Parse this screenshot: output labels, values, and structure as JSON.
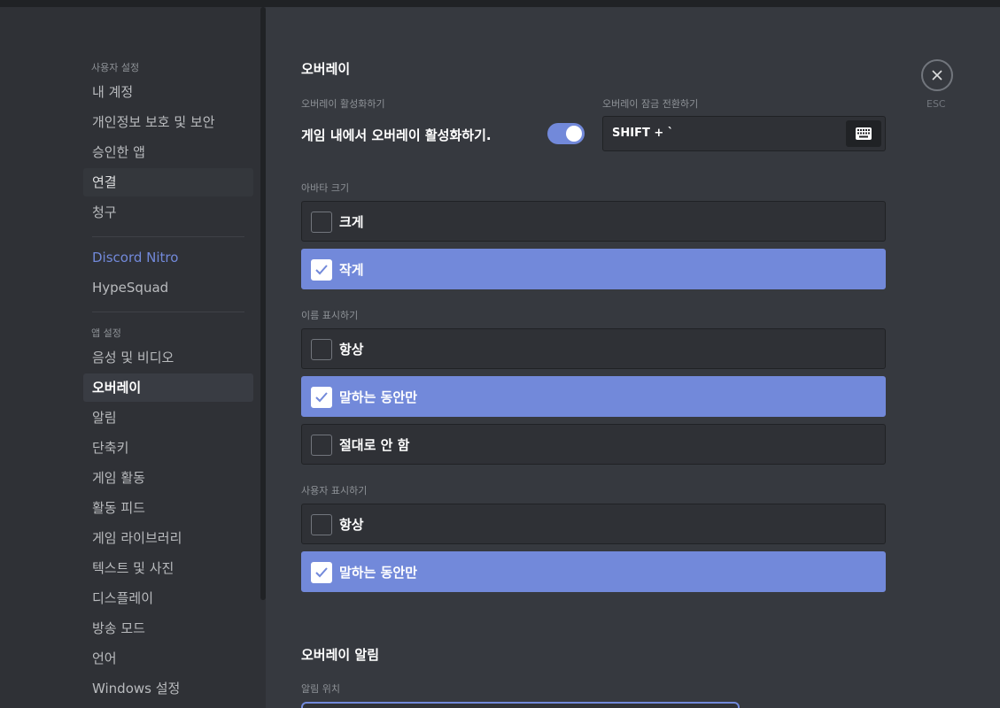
{
  "sidebar": {
    "user_settings_header": "사용자 설정",
    "user_items": [
      {
        "label": "내 계정"
      },
      {
        "label": "개인정보 보호 및 보안"
      },
      {
        "label": "승인한 앱"
      },
      {
        "label": "연결"
      },
      {
        "label": "청구"
      }
    ],
    "special_items": [
      {
        "label": "Discord Nitro"
      },
      {
        "label": "HypeSquad"
      }
    ],
    "app_settings_header": "앱 설정",
    "app_items": [
      {
        "label": "음성 및 비디오"
      },
      {
        "label": "오버레이"
      },
      {
        "label": "알림"
      },
      {
        "label": "단축키"
      },
      {
        "label": "게임 활동"
      },
      {
        "label": "활동 피드"
      },
      {
        "label": "게임 라이브러리"
      },
      {
        "label": "텍스트 및 사진"
      },
      {
        "label": "디스플레이"
      },
      {
        "label": "방송 모드"
      },
      {
        "label": "언어"
      },
      {
        "label": "Windows 설정"
      }
    ],
    "active_item": "오버레이"
  },
  "overlay": {
    "title": "오버레이",
    "enable_label": "오버레이 활성화하기",
    "enable_text": "게임 내에서 오버레이 활성화하기.",
    "enabled": true,
    "lock_label": "오버레이 잠금 전환하기",
    "lock_keybind": "SHIFT + `",
    "avatar_size": {
      "label": "아바타 크기",
      "options": [
        {
          "label": "크게",
          "checked": false
        },
        {
          "label": "작게",
          "checked": true
        }
      ]
    },
    "show_names": {
      "label": "이름 표시하기",
      "options": [
        {
          "label": "항상",
          "checked": false
        },
        {
          "label": "말하는 동안만",
          "checked": true
        },
        {
          "label": "절대로 안 함",
          "checked": false
        }
      ]
    },
    "show_users": {
      "label": "사용자 표시하기",
      "options": [
        {
          "label": "항상",
          "checked": false
        },
        {
          "label": "말하는 동안만",
          "checked": true
        }
      ]
    },
    "notifications_title": "오버레이 알림",
    "notification_position_label": "알림 위치"
  },
  "close": {
    "label": "ESC",
    "icon": "close-icon"
  },
  "colors": {
    "accent": "#7289da",
    "background": "#36393f",
    "sidebar": "#2f3136"
  }
}
